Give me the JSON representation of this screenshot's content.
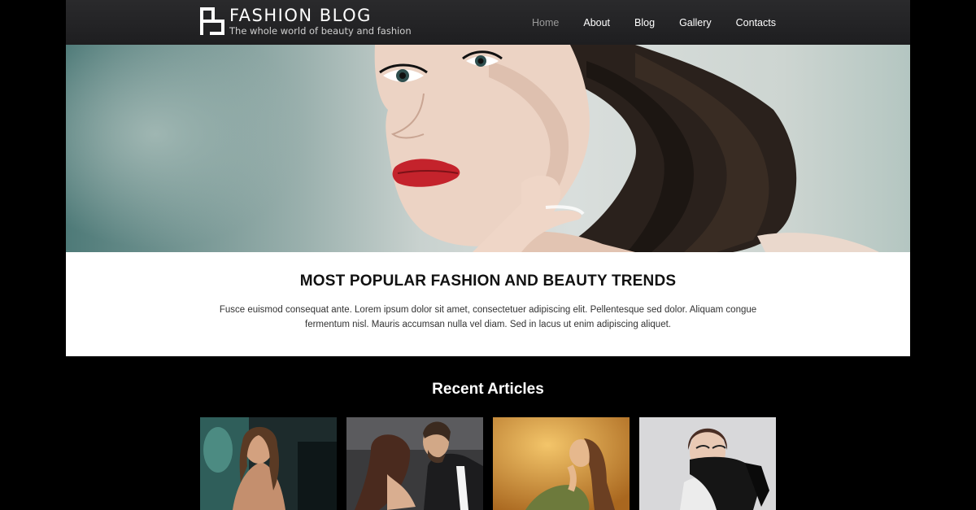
{
  "header": {
    "logo_title": "FASHION  BLOG",
    "logo_tagline": "The whole world of beauty and fashion",
    "nav": [
      {
        "label": "Home",
        "active": true
      },
      {
        "label": "About",
        "active": false
      },
      {
        "label": "Blog",
        "active": false
      },
      {
        "label": "Gallery",
        "active": false
      },
      {
        "label": "Contacts",
        "active": false
      }
    ]
  },
  "intro": {
    "title": "MOST POPULAR FASHION AND BEAUTY TRENDS",
    "text": "Fusce euismod consequat ante. Lorem ipsum dolor sit amet, consectetuer adipiscing elit. Pellentesque sed dolor. Aliquam congue fermentum nisl. Mauris accumsan nulla vel diam. Sed in lacus ut enim adipiscing aliquet."
  },
  "recent": {
    "title": "Recent Articles",
    "articles": [
      {
        "image": "woman-by-teal-chair"
      },
      {
        "image": "couple-embracing"
      },
      {
        "image": "woman-in-autumn-field"
      },
      {
        "image": "woman-with-black-scarf"
      }
    ]
  },
  "colors": {
    "background": "#000000",
    "header": "#222224",
    "nav_active": "#9a9a9a",
    "text_light": "#ffffff"
  }
}
